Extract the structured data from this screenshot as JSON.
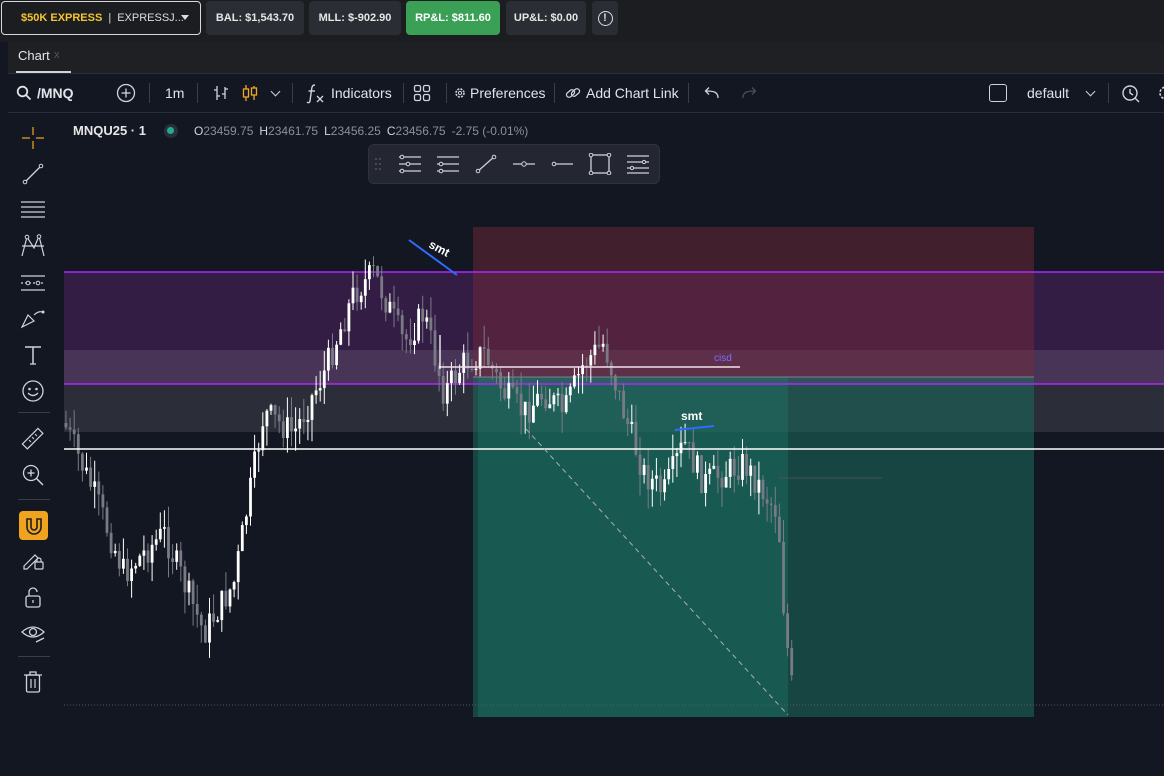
{
  "account_bar": {
    "account_name": "$50K EXPRESS",
    "account_id": "EXPRESSJ...",
    "balance": "BAL: $1,543.70",
    "mll": "MLL: $-902.90",
    "rpl": "RP&L: $811.60",
    "upl": "UP&L: $0.00",
    "info_icon": "info-icon",
    "colors": {
      "rpl_bg": "#3aa055",
      "account_name": "#f4c430"
    }
  },
  "tabs": [
    {
      "label": "Chart",
      "close": "x"
    }
  ],
  "toolbar": {
    "symbol": "/MNQ",
    "interval": "1m",
    "indicators_label": "Indicators",
    "preferences_label": "Preferences",
    "add_chart_link_label": "Add Chart Link",
    "layout_name": "default",
    "icons": [
      "search-icon",
      "add-symbol-icon",
      "bar-style-icon",
      "candle-style-icon",
      "fx-icon",
      "templates-grid-icon",
      "gear-icon",
      "link-icon",
      "undo-icon",
      "redo-icon",
      "checkbox-icon",
      "alert-icon"
    ]
  },
  "left_tools": [
    "crosshair-icon",
    "trendline-icon",
    "fib-lines-icon",
    "pattern-icon",
    "projection-icon",
    "brush-icon",
    "text-icon",
    "emoji-icon",
    "ruler-icon",
    "zoom-in-icon",
    "magnet-icon",
    "lock-drawing-icon",
    "unlock-icon",
    "eye-icon",
    "trash-icon"
  ],
  "legend": {
    "symbol": "MNQU25 · 1",
    "o_label": "O",
    "o": "23459.75",
    "h_label": "H",
    "h": "23461.75",
    "l_label": "L",
    "l": "23456.25",
    "c_label": "C",
    "c": "23456.75",
    "change": "-2.75 (-0.01%)",
    "status_color": "#22ab94"
  },
  "floating_toolbar": [
    "drag-handle-icon",
    "horizontal-ray-levels-icon",
    "parallel-levels-icon",
    "trendline-icon",
    "horizontal-segment-icon",
    "horizontal-line-icon",
    "rectangle-icon",
    "menu-lines-icon"
  ],
  "annotations": {
    "smt_top": "smt",
    "smt_mid": "smt",
    "cisd": "cisd"
  },
  "chart_data": {
    "type": "candlestick",
    "symbol": "MNQU25",
    "interval": "1",
    "colors": {
      "up": "#ffffff",
      "down": "#787b86",
      "zone_supply": "#5a2a45",
      "zone_band": "#b026ff",
      "long_target": "#1a5a4e",
      "long_stop": "#5a2a38"
    }
  }
}
